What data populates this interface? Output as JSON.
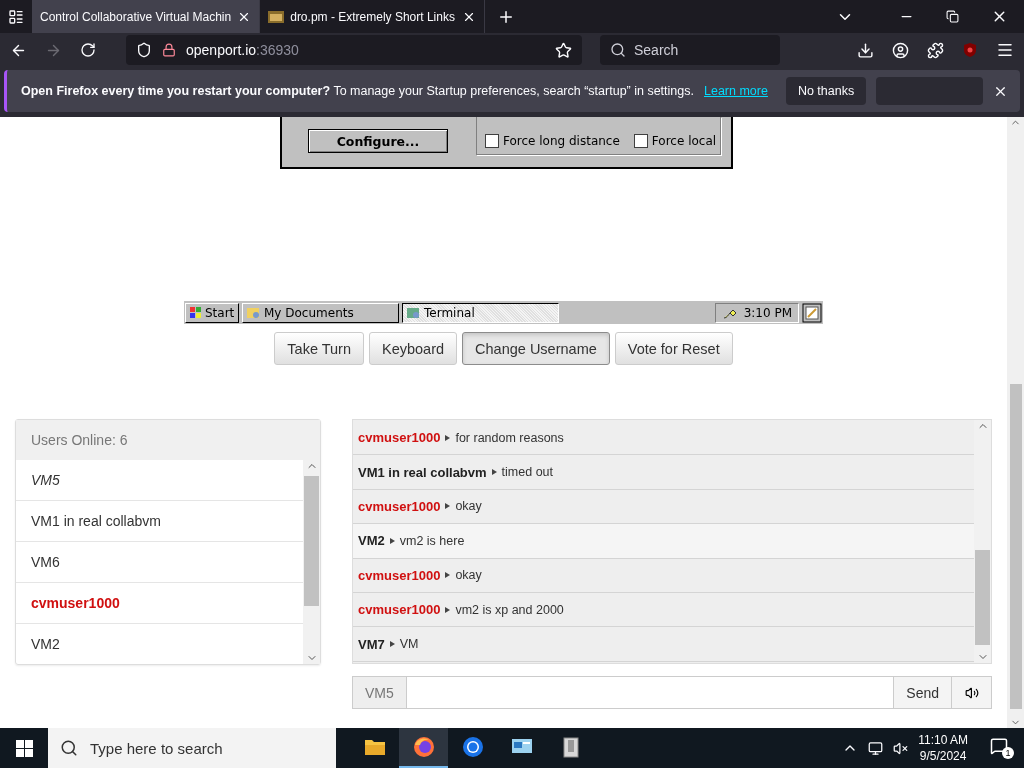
{
  "browser": {
    "tabs": [
      {
        "title": "Control Collaborative Virtual Machin",
        "selected": true
      },
      {
        "title": "dro.pm - Extremely Short Links",
        "selected": false
      }
    ],
    "address": {
      "host": "openport.io",
      "port": ":36930"
    },
    "search_placeholder": "Search",
    "notification": {
      "title": "Open Firefox every time you restart your computer?",
      "text": "To manage your Startup preferences, search “startup” in settings.",
      "link": "Learn more",
      "button": "No thanks"
    }
  },
  "vm_screen": {
    "dialog": {
      "button": "Configure...",
      "checkboxes": [
        {
          "label": "Force long distance",
          "checked": false
        },
        {
          "label": "Force local",
          "checked": false
        }
      ]
    },
    "taskbar": {
      "start": "Start",
      "tasks": [
        {
          "label": "My Documents",
          "selected": false
        },
        {
          "label": "Terminal",
          "selected": true
        }
      ],
      "clock": "3:10 PM"
    }
  },
  "controls": [
    {
      "label": "Take Turn",
      "selected": false
    },
    {
      "label": "Keyboard",
      "selected": false
    },
    {
      "label": "Change Username",
      "selected": true
    },
    {
      "label": "Vote for Reset",
      "selected": false
    }
  ],
  "users": {
    "title": "Users Online: 6",
    "items": [
      {
        "name": "VM5",
        "kind": "self"
      },
      {
        "name": "VM1 in real collabvm",
        "kind": "user"
      },
      {
        "name": "VM6",
        "kind": "user"
      },
      {
        "name": "cvmuser1000",
        "kind": "admin"
      },
      {
        "name": "VM2",
        "kind": "user"
      }
    ]
  },
  "chat": {
    "messages": [
      {
        "user": "cvmuser1000",
        "kind": "admin",
        "text": "for random reasons"
      },
      {
        "user": "VM1 in real collabvm",
        "kind": "user",
        "text": "timed out"
      },
      {
        "user": "cvmuser1000",
        "kind": "admin",
        "text": "okay"
      },
      {
        "user": "VM2",
        "kind": "user",
        "text": "vm2 is here"
      },
      {
        "user": "cvmuser1000",
        "kind": "admin",
        "text": "okay"
      },
      {
        "user": "cvmuser1000",
        "kind": "admin",
        "text": "vm2 is xp and 2000"
      },
      {
        "user": "VM7",
        "kind": "user",
        "text": "VM"
      }
    ],
    "username": "VM5",
    "send": "Send"
  },
  "os_taskbar": {
    "search_placeholder": "Type here to search",
    "apps": [
      {
        "kind": "files",
        "selected": false
      },
      {
        "kind": "firefox",
        "selected": true
      },
      {
        "kind": "chrome",
        "selected": false
      },
      {
        "kind": "remote",
        "selected": false
      },
      {
        "kind": "archive",
        "selected": false
      }
    ],
    "time": "11:10 AM",
    "date": "9/5/2024",
    "notifications": "1"
  }
}
